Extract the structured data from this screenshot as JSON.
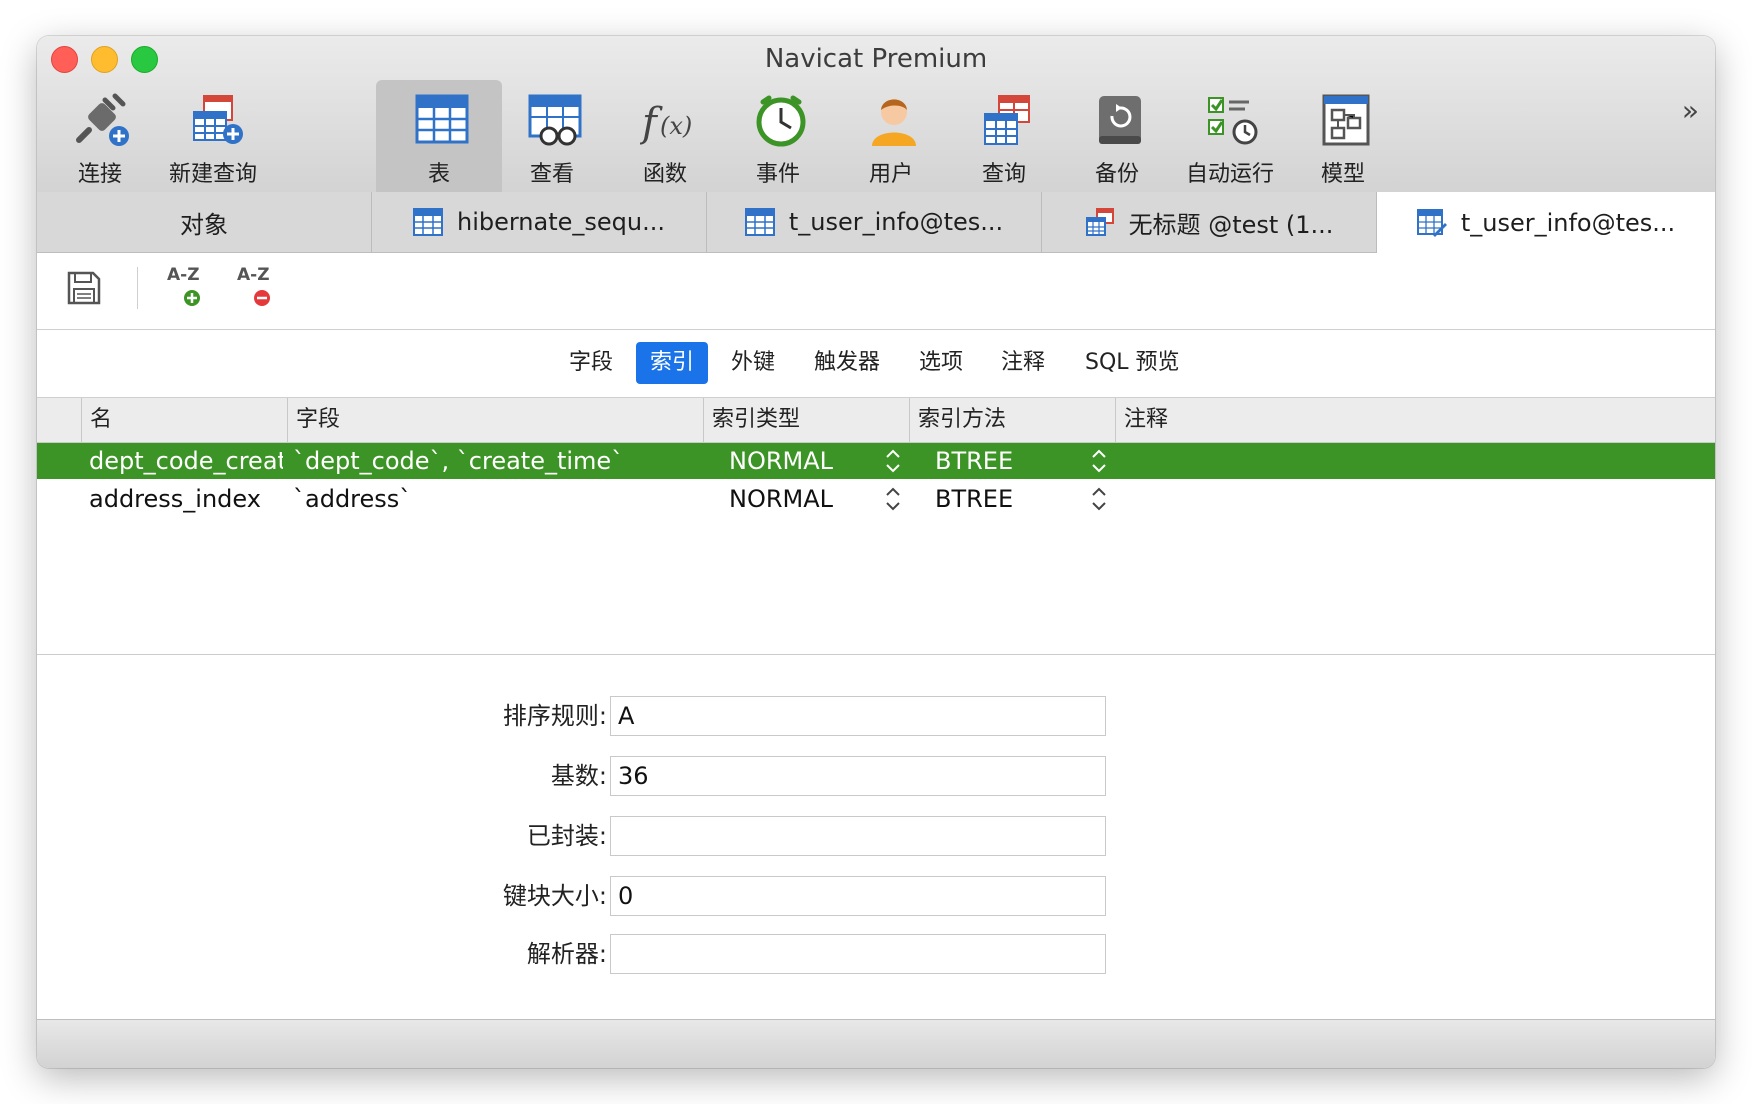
{
  "window": {
    "title": "Navicat Premium"
  },
  "toolbar": {
    "items": [
      {
        "label": "连接",
        "icon": "plug-add-icon"
      },
      {
        "label": "新建查询",
        "icon": "new-query-icon"
      },
      {
        "label": "表",
        "icon": "table-icon",
        "active": true
      },
      {
        "label": "查看",
        "icon": "view-icon"
      },
      {
        "label": "函数",
        "icon": "function-icon"
      },
      {
        "label": "事件",
        "icon": "clock-icon"
      },
      {
        "label": "用户",
        "icon": "user-icon"
      },
      {
        "label": "查询",
        "icon": "query-icon"
      },
      {
        "label": "备份",
        "icon": "backup-icon"
      },
      {
        "label": "自动运行",
        "icon": "automation-icon"
      },
      {
        "label": "模型",
        "icon": "model-icon"
      }
    ],
    "more": "»"
  },
  "tabs": [
    {
      "label": "对象"
    },
    {
      "label": "hibernate_sequ..."
    },
    {
      "label": "t_user_info@tes..."
    },
    {
      "label": "无标题 @test (1..."
    },
    {
      "label": "t_user_info@tes...",
      "active": true
    }
  ],
  "editbar": {
    "sort_add": "A-Z",
    "sort_remove": "A-Z"
  },
  "subtabs": [
    "字段",
    "索引",
    "外键",
    "触发器",
    "选项",
    "注释",
    "SQL 预览"
  ],
  "subtab_active": "索引",
  "grid": {
    "columns": [
      "名",
      "字段",
      "索引类型",
      "索引方法",
      "注释"
    ],
    "rows": [
      {
        "name": "dept_code_creat",
        "fields": "`dept_code`, `create_time`",
        "type": "NORMAL",
        "method": "BTREE",
        "comment": ""
      },
      {
        "name": "address_index",
        "fields": "`address`",
        "type": "NORMAL",
        "method": "BTREE",
        "comment": ""
      }
    ]
  },
  "form": {
    "collation_label": "排序规则:",
    "collation_value": "A",
    "cardinality_label": "基数:",
    "cardinality_value": "36",
    "packed_label": "已封装:",
    "packed_value": "",
    "key_block_label": "键块大小:",
    "key_block_value": "0",
    "parser_label": "解析器:",
    "parser_value": ""
  },
  "colors": {
    "selected_row": "#3d9426",
    "active_subtab": "#1a73e8"
  }
}
